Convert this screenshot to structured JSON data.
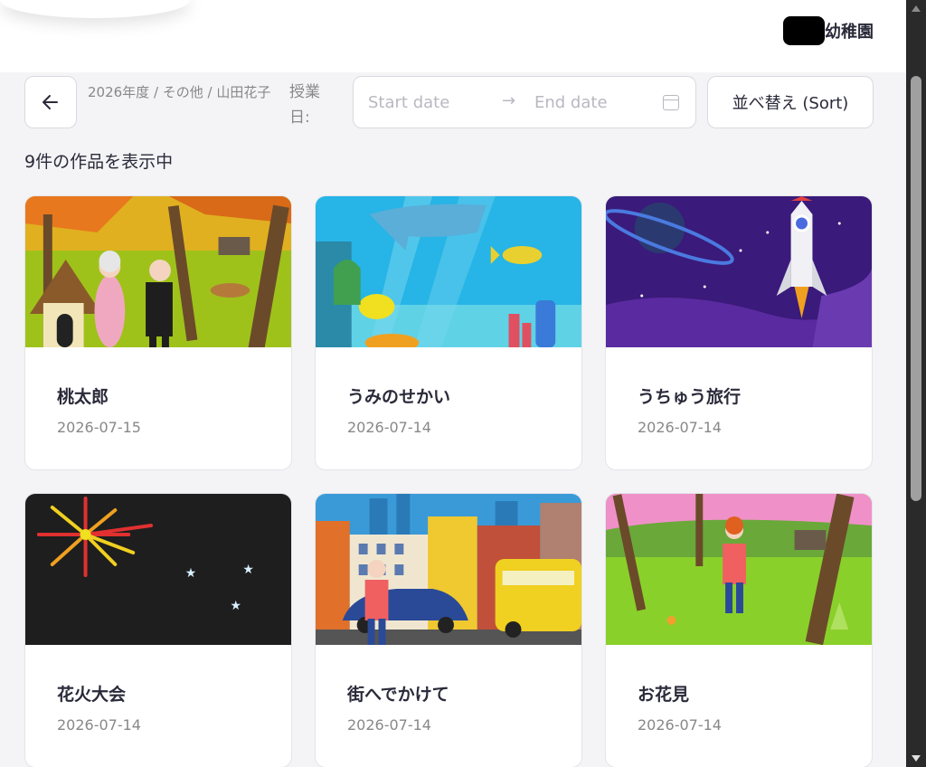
{
  "header": {
    "org_name": "幼稚園"
  },
  "toolbar": {
    "breadcrumb": "2026年度 / その他 / 山田花子",
    "date_label": "授業日:",
    "start_placeholder": "Start date",
    "end_placeholder": "End date",
    "range_arrow": "→",
    "sort_label": "並べ替え (Sort)"
  },
  "summary": {
    "count_text": "9件の作品を表示中"
  },
  "cards": [
    {
      "title": "桃太郎",
      "date": "2026-07-15",
      "scene": "autumn-house"
    },
    {
      "title": "うみのせかい",
      "date": "2026-07-14",
      "scene": "underwater"
    },
    {
      "title": "うちゅう旅行",
      "date": "2026-07-14",
      "scene": "space-rocket"
    },
    {
      "title": "花火大会",
      "date": "2026-07-14",
      "scene": "fireworks"
    },
    {
      "title": "街へでかけて",
      "date": "2026-07-14",
      "scene": "city-street"
    },
    {
      "title": "お花見",
      "date": "2026-07-14",
      "scene": "cherry-blossom-park"
    }
  ],
  "colors": {
    "background": "#f4f4f6",
    "card": "#ffffff",
    "text": "#2a2a3a",
    "muted": "#888888"
  },
  "icons": [
    "arrow-left-icon",
    "calendar-icon",
    "arrow-right-icon"
  ]
}
